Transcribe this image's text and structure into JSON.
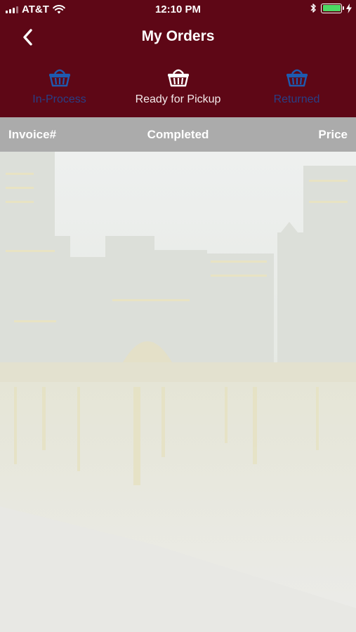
{
  "status_bar": {
    "carrier": "AT&T",
    "time": "12:10 PM",
    "battery_color": "#4cd964"
  },
  "nav": {
    "title": "My Orders",
    "back_icon": "chevron-left-icon"
  },
  "tabs": [
    {
      "label": "In-Process",
      "icon": "basket-icon",
      "active": false
    },
    {
      "label": "Ready for Pickup",
      "icon": "basket-icon",
      "active": true
    },
    {
      "label": "Returned",
      "icon": "basket-icon",
      "active": false
    }
  ],
  "table_header": {
    "invoice": "Invoice#",
    "completed": "Completed",
    "price": "Price"
  },
  "colors": {
    "brand": "#5e0716",
    "header_gray": "#ababab",
    "inactive_tab": "#283f86",
    "active_tab": "#ffffff"
  }
}
